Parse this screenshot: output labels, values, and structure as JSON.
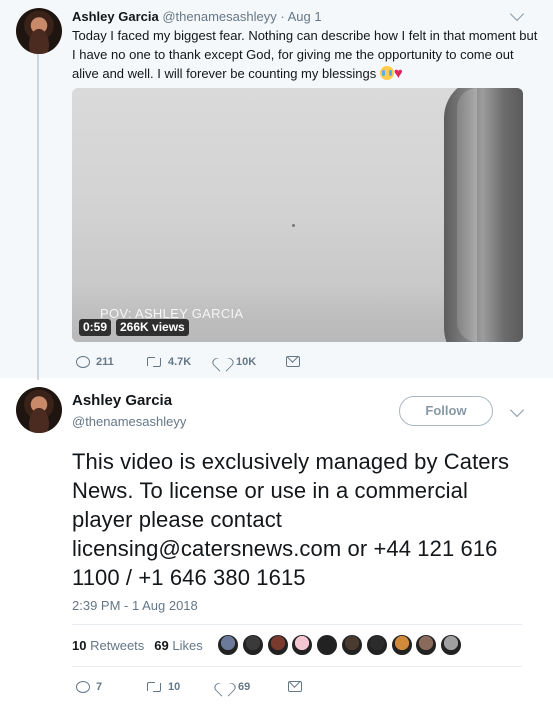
{
  "parent_tweet": {
    "author_name": "Ashley Garcia",
    "author_handle": "@thenamesashleyy",
    "dot": "·",
    "date": "Aug 1",
    "text": "Today I faced my biggest fear. Nothing can describe how I felt in that moment but I have no one to thank except God, for giving me the opportunity to come out alive and well. I will forever be counting my blessings",
    "emojis": [
      "crying-face",
      "red-heart"
    ],
    "video": {
      "watermark": "POV: ASHLEY GARCIA",
      "duration": "0:59",
      "views": "266K views"
    },
    "actions": {
      "replies": "211",
      "retweets": "4.7K",
      "likes": "10K"
    }
  },
  "main_tweet": {
    "author_name": "Ashley Garcia",
    "author_handle": "@thenamesashleyy",
    "follow_label": "Follow",
    "text": "This video is exclusively managed by Caters News. To license or use in a commercial player please contact licensing@catersnews.com or +44 121 616 1100 / +1 646 380 1615",
    "timestamp": "2:39 PM - 1 Aug 2018",
    "stats": {
      "retweets_count": "10",
      "retweets_label": "Retweets",
      "likes_count": "69",
      "likes_label": "Likes"
    },
    "liker_avatar_colors": [
      "#6b7a99",
      "#3a3a3a",
      "#7a3b2e",
      "#f3c6d2",
      "#222222",
      "#4a3a30",
      "#2c2c2c",
      "#d08a3a",
      "#8a6a5a",
      "#a0a0a0"
    ],
    "actions": {
      "replies": "7",
      "retweets": "10",
      "likes": "69"
    }
  },
  "colors": {
    "text_primary": "#14171a",
    "text_secondary": "#657786",
    "parent_background": "#f5f8fa",
    "heart": "#e0245e",
    "border": "#e6ecf0"
  }
}
